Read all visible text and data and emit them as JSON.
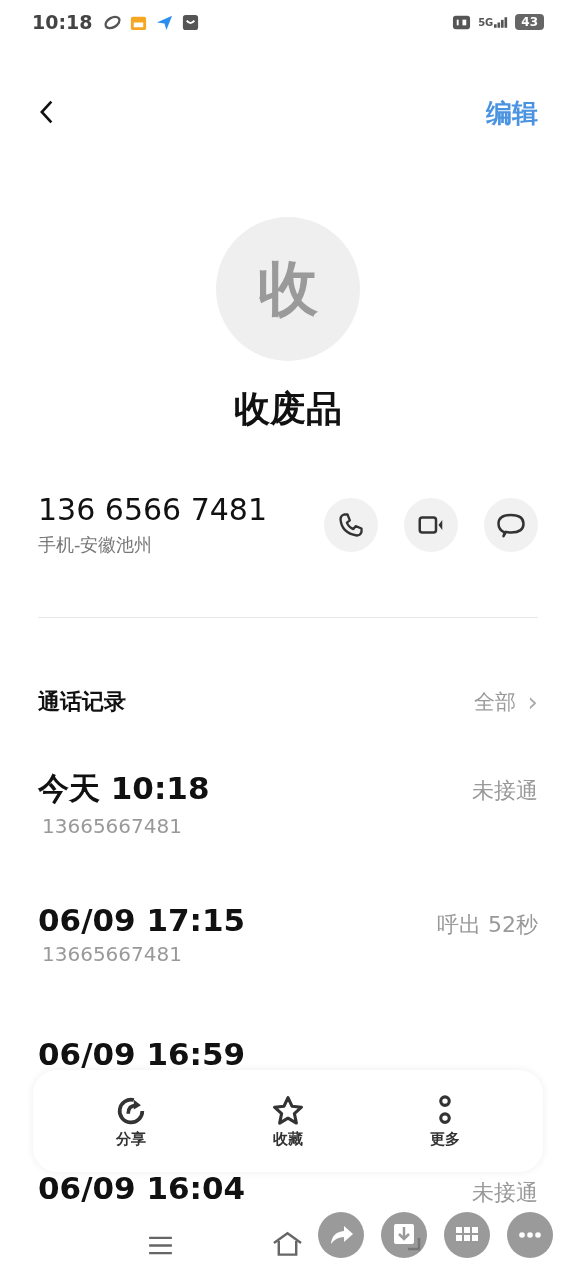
{
  "status_bar": {
    "time": "10:18",
    "network": "5G",
    "battery": "43"
  },
  "header": {
    "edit": "编辑"
  },
  "contact": {
    "avatar": "收",
    "name": "收废品",
    "phone": "136 6566 7481",
    "phone_label": "手机-安徽池州"
  },
  "call_log": {
    "title": "通话记录",
    "all": "全部",
    "chevron": "›",
    "entries": [
      {
        "time": "今天 10:18",
        "number": "13665667481",
        "result": "未接通"
      },
      {
        "time": "06/09 17:15",
        "number": "13665667481",
        "result": "呼出 52秒"
      },
      {
        "time": "06/09 16:59"
      },
      {
        "time": "06/09 16:04",
        "result": "未接通"
      }
    ]
  },
  "actions": [
    {
      "kind": "share",
      "label": "分享"
    },
    {
      "kind": "favorite",
      "label": "收藏"
    },
    {
      "kind": "more",
      "label": "更多"
    }
  ]
}
